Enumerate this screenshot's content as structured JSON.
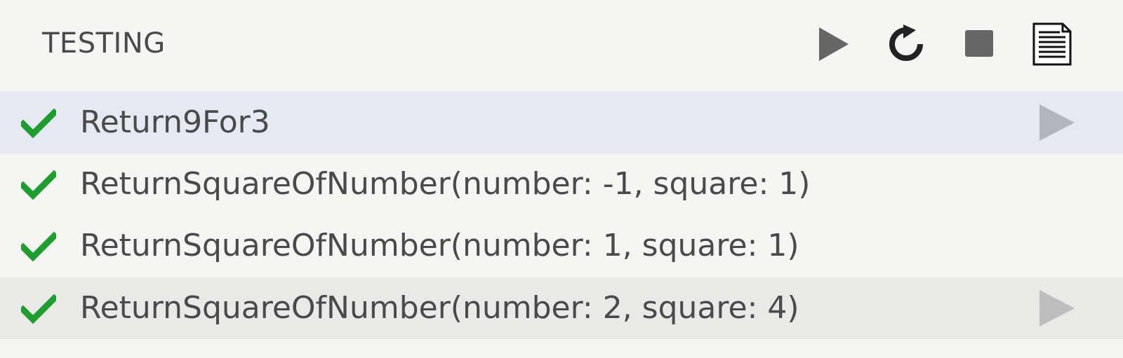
{
  "header": {
    "title": "TESTING",
    "toolbar": [
      {
        "action": "run",
        "icon": "play-icon"
      },
      {
        "action": "refresh",
        "icon": "refresh-icon"
      },
      {
        "action": "stop",
        "icon": "stop-icon"
      },
      {
        "action": "show-output",
        "icon": "document-icon"
      }
    ]
  },
  "tests": [
    {
      "label": "Return9For3",
      "status": "passed",
      "icon": "check-icon",
      "selected": true,
      "run_icon_visible": true
    },
    {
      "label": "ReturnSquareOfNumber(number: -1, square: 1)",
      "status": "passed",
      "icon": "check-icon",
      "selected": false,
      "run_icon_visible": false
    },
    {
      "label": "ReturnSquareOfNumber(number: 1, square: 1)",
      "status": "passed",
      "icon": "check-icon",
      "selected": false,
      "run_icon_visible": false
    },
    {
      "label": "ReturnSquareOfNumber(number: 2, square: 4)",
      "status": "passed",
      "icon": "check-icon",
      "selected": false,
      "hovered": true,
      "run_icon_visible": true
    }
  ],
  "colors": {
    "background": "#f5f5f3",
    "selected_row": "#e6e8f2",
    "hover_row": "#e9e9e8",
    "pass_green": "#1f9d2f",
    "text": "#4a4a4a",
    "toolbar_icon": "#666666"
  }
}
